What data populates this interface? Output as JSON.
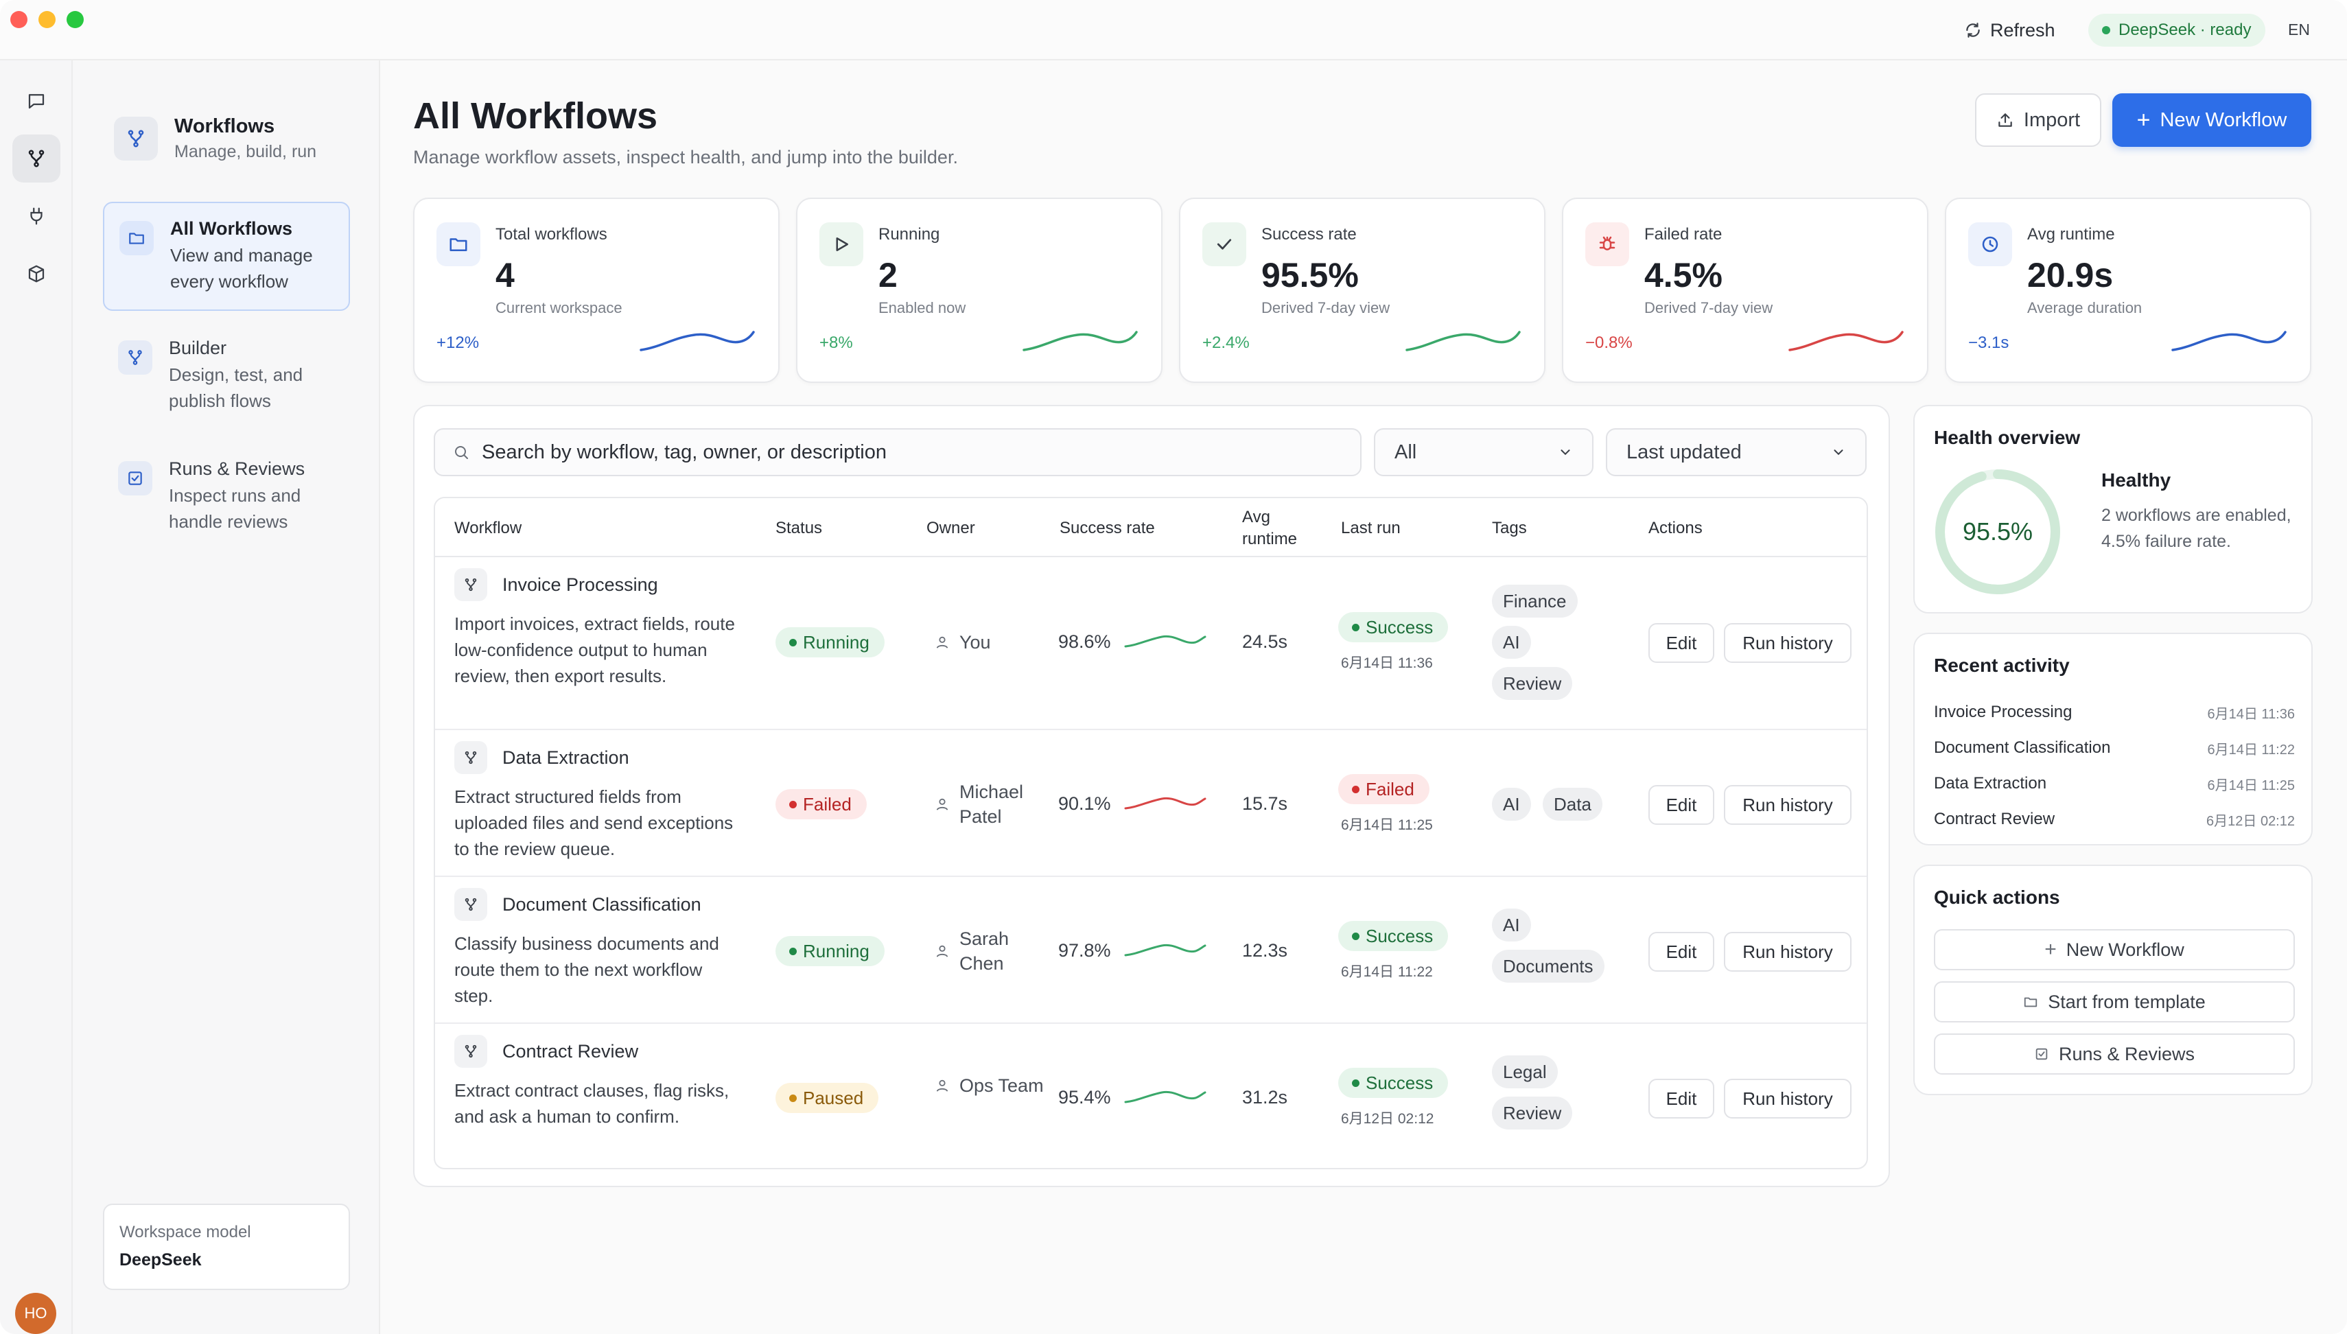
{
  "topbar": {
    "refresh_label": "Refresh",
    "model_status": "DeepSeek · ready",
    "language": "EN"
  },
  "rail": {
    "items": [
      "chat-icon",
      "workflow-icon",
      "plug-icon",
      "box-icon"
    ],
    "active_index": 1,
    "avatar_initials": "HO"
  },
  "nav": {
    "header_title": "Workflows",
    "header_subtitle": "Manage, build, run",
    "items": [
      {
        "title": "All Workflows",
        "desc": "View and manage every workflow",
        "icon": "folder-icon"
      },
      {
        "title": "Builder",
        "desc": "Design, test, and publish flows",
        "icon": "workflow-icon"
      },
      {
        "title": "Runs & Reviews",
        "desc": "Inspect runs and handle reviews",
        "icon": "checklist-icon"
      }
    ],
    "workspace_model_label": "Workspace model",
    "workspace_model_value": "DeepSeek"
  },
  "page": {
    "title": "All Workflows",
    "subtitle": "Manage workflow assets, inspect health, and jump into the builder.",
    "import_label": "Import",
    "new_workflow_label": "New Workflow"
  },
  "stats": [
    {
      "label": "Total workflows",
      "value": "4",
      "desc": "Current workspace",
      "delta": "+12%",
      "color": "#2d5fc8",
      "icon_bg": "#edf2fc",
      "icon": "folder-icon"
    },
    {
      "label": "Running",
      "value": "2",
      "desc": "Enabled now",
      "delta": "+8%",
      "color": "#3aa86a",
      "icon_bg": "#ecf6ef",
      "icon": "play-icon"
    },
    {
      "label": "Success rate",
      "value": "95.5%",
      "desc": "Derived 7-day view",
      "delta": "+2.4%",
      "color": "#3aa86a",
      "icon_bg": "#ecf6ef",
      "icon": "check-icon"
    },
    {
      "label": "Failed rate",
      "value": "4.5%",
      "desc": "Derived 7-day view",
      "delta": "−0.8%",
      "color": "#d84545",
      "icon_bg": "#fdeded",
      "icon": "bug-icon"
    },
    {
      "label": "Avg runtime",
      "value": "20.9s",
      "desc": "Average duration",
      "delta": "−3.1s",
      "color": "#2d5fc8",
      "icon_bg": "#edf2fc",
      "icon": "clock-icon"
    }
  ],
  "filters": {
    "search_placeholder": "Search by workflow, tag, owner, or description",
    "status_value": "All",
    "sort_value": "Last updated"
  },
  "table": {
    "headers": {
      "workflow": "Workflow",
      "status": "Status",
      "owner": "Owner",
      "success_rate": "Success rate",
      "avg_runtime": "Avg runtime",
      "last_run": "Last run",
      "tags": "Tags",
      "actions": "Actions"
    },
    "edit_label": "Edit",
    "history_label": "Run history",
    "rows": [
      {
        "name": "Invoice Processing",
        "desc": "Import invoices, extract fields, route low-confidence output to human review, then export results.",
        "status": "Running",
        "status_kind": "ok",
        "owner": "You",
        "rate": "98.6%",
        "rate_color": "#3aa86a",
        "runtime": "24.5s",
        "last_run_status": "Success",
        "last_run_kind": "ok",
        "last_run_time": "6月14日 11:36",
        "tags": [
          "Finance",
          "AI",
          "Review"
        ]
      },
      {
        "name": "Data Extraction",
        "desc": "Extract structured fields from uploaded files and send exceptions to the review queue.",
        "status": "Failed",
        "status_kind": "bad",
        "owner": "Michael Patel",
        "rate": "90.1%",
        "rate_color": "#d84545",
        "runtime": "15.7s",
        "last_run_status": "Failed",
        "last_run_kind": "bad",
        "last_run_time": "6月14日 11:25",
        "tags": [
          "AI",
          "Data"
        ]
      },
      {
        "name": "Document Classification",
        "desc": "Classify business documents and route them to the next workflow step.",
        "status": "Running",
        "status_kind": "ok",
        "owner": "Sarah Chen",
        "rate": "97.8%",
        "rate_color": "#3aa86a",
        "runtime": "12.3s",
        "last_run_status": "Success",
        "last_run_kind": "ok",
        "last_run_time": "6月14日 11:22",
        "tags": [
          "AI",
          "Documents"
        ]
      },
      {
        "name": "Contract Review",
        "desc": "Extract contract clauses, flag risks, and ask a human to confirm.",
        "status": "Paused",
        "status_kind": "pause",
        "owner": "Ops Team",
        "rate": "95.4%",
        "rate_color": "#3aa86a",
        "runtime": "31.2s",
        "last_run_status": "Success",
        "last_run_kind": "ok",
        "last_run_time": "6月12日 02:12",
        "tags": [
          "Legal",
          "Review"
        ]
      }
    ]
  },
  "health": {
    "title": "Health overview",
    "value": "95.5%",
    "fraction": 0.955,
    "status": "Healthy",
    "desc": "2 workflows are enabled, 4.5% failure rate."
  },
  "activity": {
    "title": "Recent activity",
    "items": [
      {
        "name": "Invoice Processing",
        "time": "6月14日 11:36"
      },
      {
        "name": "Document Classification",
        "time": "6月14日 11:22"
      },
      {
        "name": "Data Extraction",
        "time": "6月14日 11:25"
      },
      {
        "name": "Contract Review",
        "time": "6月12日 02:12"
      }
    ]
  },
  "quick_actions": {
    "title": "Quick actions",
    "new_workflow": "New Workflow",
    "start_template": "Start from template",
    "runs_reviews": "Runs & Reviews"
  }
}
